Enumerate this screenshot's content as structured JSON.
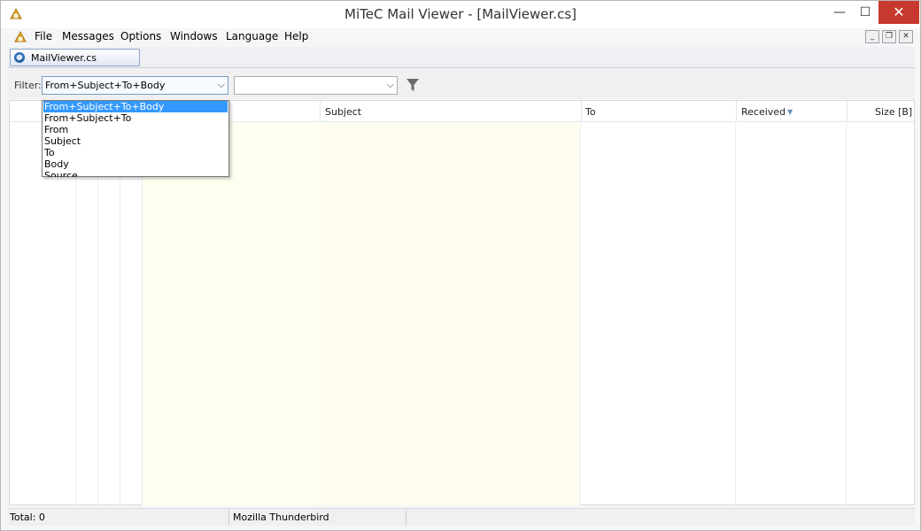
{
  "window": {
    "title": "MiTeC Mail Viewer - [MailViewer.cs]",
    "min_glyph": "—",
    "max_glyph": "☐",
    "close_glyph": "✕"
  },
  "menu": {
    "items": [
      "File",
      "Messages",
      "Options",
      "Windows",
      "Language",
      "Help"
    ]
  },
  "mdi_controls": {
    "minimize": "_",
    "restore": "❐",
    "close": "✕"
  },
  "tabs": [
    {
      "label": "MailViewer.cs",
      "icon": "thunderbird-icon"
    }
  ],
  "filter": {
    "label": "Filter:",
    "field_value": "From+Subject+To+Body",
    "value": "",
    "options": [
      "From+Subject+To+Body",
      "From+Subject+To",
      "From",
      "Subject",
      "To",
      "Body",
      "Source"
    ],
    "selected_index": 0,
    "icon": "funnel-icon"
  },
  "grid": {
    "columns": [
      "Subject",
      "To",
      "Received",
      "Size [B]"
    ],
    "sort_column": "Received",
    "sort_glyph": "▼"
  },
  "status": {
    "total": "Total: 0",
    "client": "Mozilla Thunderbird"
  },
  "colors": {
    "highlight_column": "#fffff0",
    "subject_column": "#fffcf0",
    "selection": "#3399ff",
    "close_button": "#c7382e"
  }
}
